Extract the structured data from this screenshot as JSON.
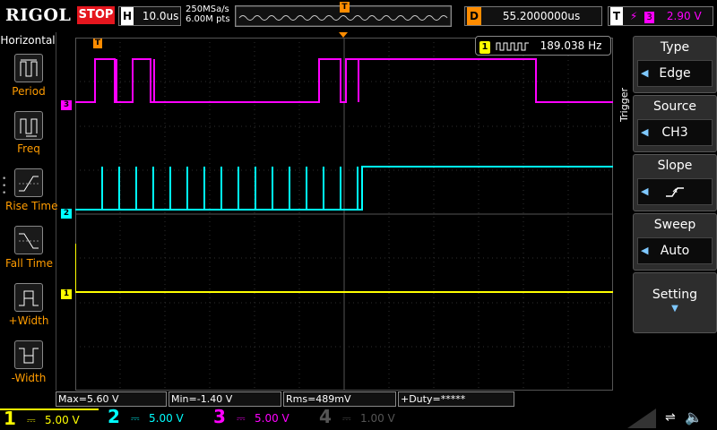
{
  "topbar": {
    "logo": "RIGOL",
    "run_state": "STOP",
    "timebase_label": "H",
    "timebase_value": "10.0us",
    "sample_rate": "250MSa/s",
    "memory_depth": "6.00M pts",
    "trigger_marker": "T",
    "delay_label": "D",
    "delay_value": "55.2000000us",
    "trigger_label": "T",
    "trigger_source_num": "3",
    "trigger_level": "2.90 V"
  },
  "left_panel": {
    "title": "Horizontal",
    "items": [
      {
        "label": "Period"
      },
      {
        "label": "Freq"
      },
      {
        "label": "Rise Time"
      },
      {
        "label": "Fall Time"
      },
      {
        "label": "+Width"
      },
      {
        "label": "-Width"
      }
    ]
  },
  "frequency_counter": {
    "channel": "1",
    "value": "189.038 Hz"
  },
  "right_menu": {
    "section_label": "Trigger",
    "items": [
      {
        "title": "Type",
        "value": "Edge"
      },
      {
        "title": "Source",
        "value": "CH3"
      },
      {
        "title": "Slope",
        "value": "rising-edge-icon"
      },
      {
        "title": "Sweep",
        "value": "Auto"
      },
      {
        "title": "Setting",
        "value": "chevron-down-icon"
      }
    ]
  },
  "channel_markers": {
    "ch3": "3",
    "ch2": "2",
    "ch1": "1"
  },
  "measurements": {
    "max": "Max=5.60 V",
    "min": "Min=-1.40 V",
    "rms": "Rms=489mV",
    "duty": "+Duty=*****"
  },
  "channels": [
    {
      "num": "1",
      "scale": "5.00 V",
      "color": "#ffff00"
    },
    {
      "num": "2",
      "scale": "5.00 V",
      "color": "#00ffff"
    },
    {
      "num": "3",
      "scale": "5.00 V",
      "color": "#ff00ff"
    },
    {
      "num": "4",
      "scale": "1.00 V",
      "color": "#3b6bd6"
    }
  ],
  "colors": {
    "accent_orange": "#ff8c00",
    "stop_red": "#e5161e"
  }
}
